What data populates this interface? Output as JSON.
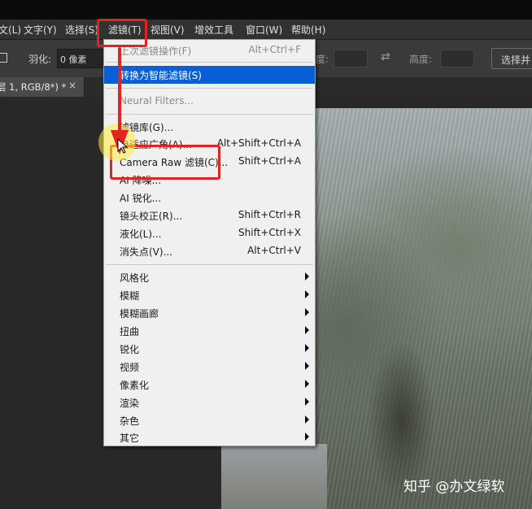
{
  "menubar": {
    "items": [
      "文(L)",
      "文字(Y)",
      "选择(S)",
      "滤镜(T)",
      "视图(V)",
      "增效工具",
      "窗口(W)",
      "帮助(H)"
    ]
  },
  "options": {
    "feather_label": "羽化:",
    "feather_value": "0 像素",
    "width_label": "度:",
    "height_label": "高度:",
    "select_button": "选择并"
  },
  "tab": {
    "title": "层 1, RGB/8*) *",
    "close": "×"
  },
  "filter_menu": {
    "last_filter": {
      "label": "上次滤镜操作(F)",
      "shortcut": "Alt+Ctrl+F"
    },
    "smart_filter": {
      "label": "转换为智能滤镜(S)"
    },
    "neural": {
      "label": "Neural Filters..."
    },
    "filter_gallery": {
      "label": "滤镜库(G)..."
    },
    "adaptive_wide": {
      "label": "自适应广角(A)...",
      "shortcut": "Alt+Shift+Ctrl+A"
    },
    "camera_raw": {
      "label": "Camera Raw 滤镜(C)...",
      "shortcut": "Shift+Ctrl+A"
    },
    "ai_denoise": {
      "label": "AI 降噪..."
    },
    "ai_sharpen": {
      "label": "AI 锐化..."
    },
    "lens_correction": {
      "label": "镜头校正(R)...",
      "shortcut": "Shift+Ctrl+R"
    },
    "liquify": {
      "label": "液化(L)...",
      "shortcut": "Shift+Ctrl+X"
    },
    "vanishing_point": {
      "label": "消失点(V)...",
      "shortcut": "Alt+Ctrl+V"
    },
    "submenus": [
      "风格化",
      "模糊",
      "模糊画廊",
      "扭曲",
      "锐化",
      "视频",
      "像素化",
      "渲染",
      "杂色",
      "其它"
    ]
  },
  "watermark": "知乎 @办文绿软",
  "colors": {
    "highlight": "#0a5fd6",
    "annotation": "#e32222"
  }
}
